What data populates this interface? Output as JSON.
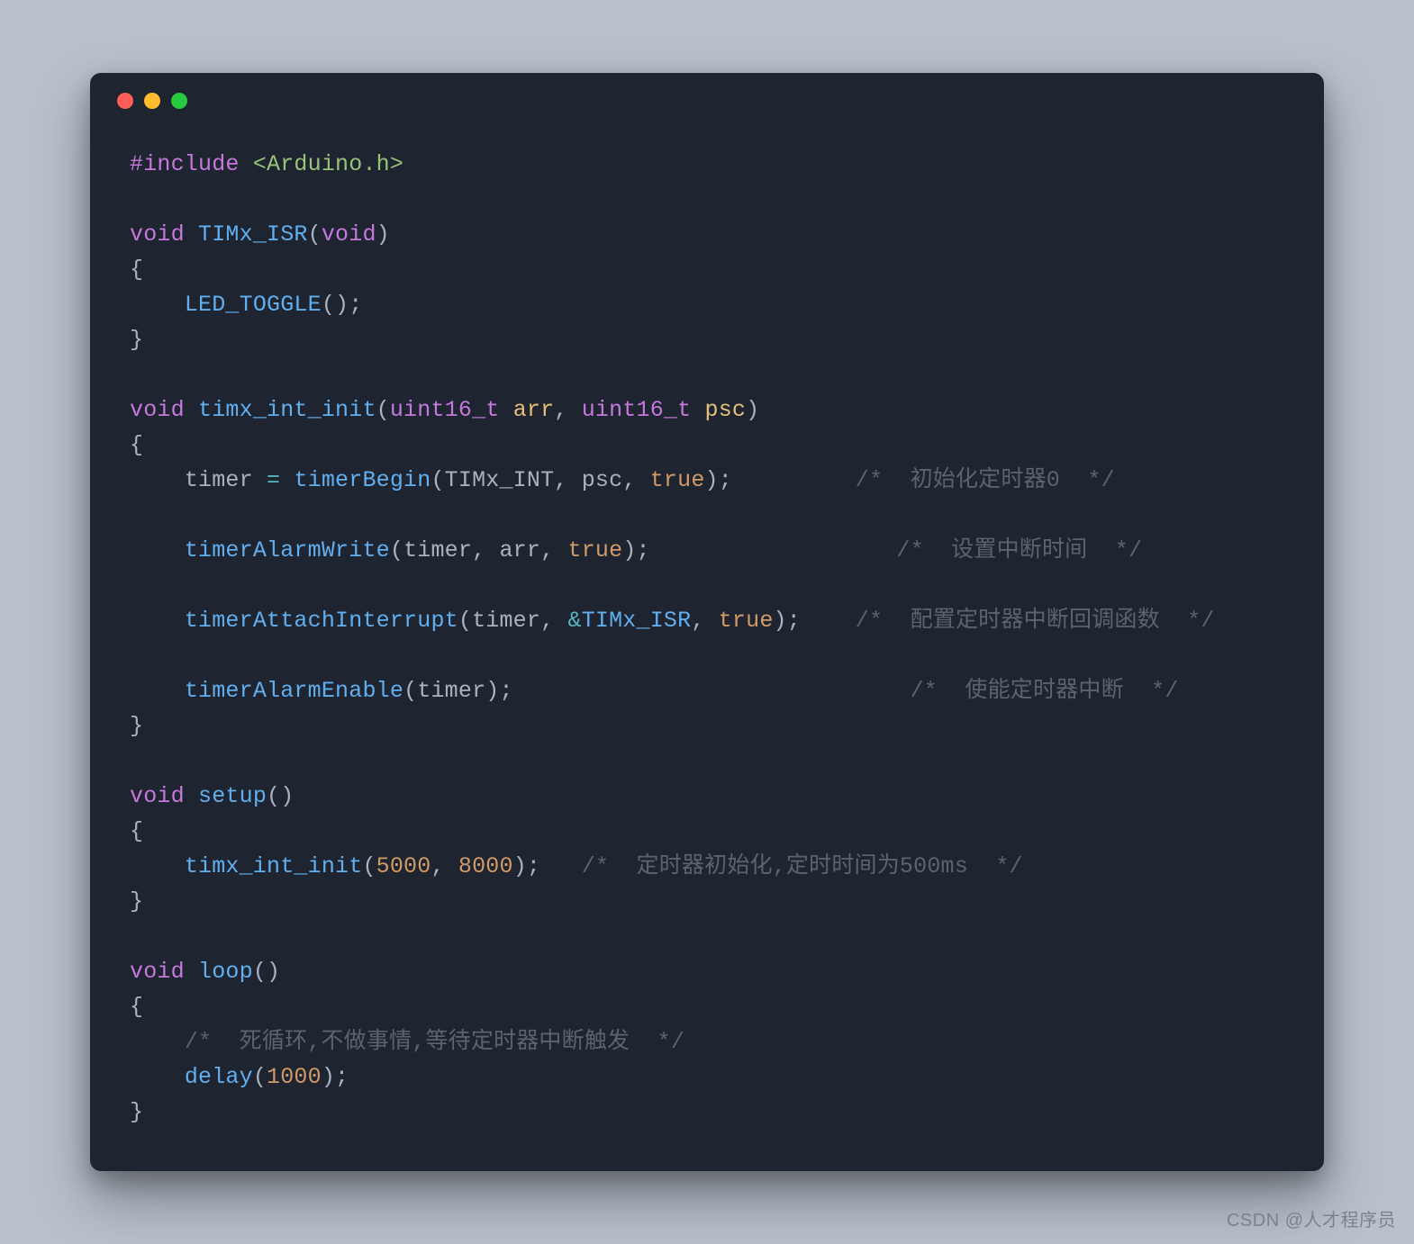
{
  "titlebar": {
    "dots": [
      "red",
      "yellow",
      "green"
    ]
  },
  "tok": {
    "include": "#include",
    "header": "<Arduino.h>",
    "void": "void",
    "uint16": "uint16_t",
    "true": "true"
  },
  "fn": {
    "TIMx_ISR": "TIMx_ISR",
    "LED_TOGGLE": "LED_TOGGLE",
    "timx_int_init": "timx_int_init",
    "timerBegin": "timerBegin",
    "timerAlarmWrite": "timerAlarmWrite",
    "timerAttachInterrupt": "timerAttachInterrupt",
    "timerAlarmEnable": "timerAlarmEnable",
    "setup": "setup",
    "loop": "loop",
    "delay": "delay"
  },
  "id": {
    "arr": "arr",
    "psc": "psc",
    "timer": "timer",
    "TIMx_INT": "TIMx_INT"
  },
  "num": {
    "n5000": "5000",
    "n8000": "8000",
    "n1000": "1000"
  },
  "cmt": {
    "c1": "/*  初始化定时器0  */",
    "c2": "/*  设置中断时间  */",
    "c3": "/*  配置定时器中断回调函数  */",
    "c4": "/*  使能定时器中断  */",
    "c5": "/*  定时器初始化,定时时间为500ms  */",
    "c6": "/*  死循环,不做事情,等待定时器中断触发  */"
  },
  "watermark": "CSDN @人才程序员"
}
